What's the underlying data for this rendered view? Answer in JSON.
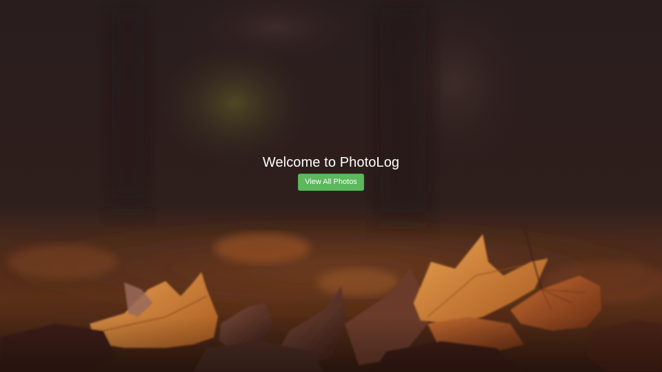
{
  "hero": {
    "title": "Welcome to PhotoLog",
    "button_label": "View All Photos"
  },
  "colors": {
    "button": "#5cb85c",
    "title_text": "#ffffff",
    "background_dark": "#2b1e1c"
  }
}
